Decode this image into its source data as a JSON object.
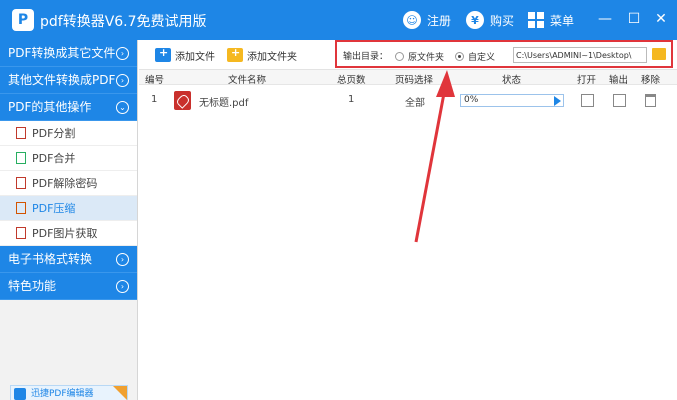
{
  "app": {
    "title": "pdf转换器V6.7免费试用版",
    "logo_text": "P"
  },
  "titlebar": {
    "register_label": "注册",
    "buy_label": "购买",
    "menu_label": "菜单"
  },
  "sidebar": {
    "groups": [
      {
        "label": "PDF转换成其它文件"
      },
      {
        "label": "其他文件转换成PDF"
      },
      {
        "label": "PDF的其他操作"
      },
      {
        "label": "电子书格式转换"
      },
      {
        "label": "特色功能"
      }
    ],
    "items": [
      {
        "label": "PDF分割"
      },
      {
        "label": "PDF合并"
      },
      {
        "label": "PDF解除密码"
      },
      {
        "label": "PDF压缩"
      },
      {
        "label": "PDF图片获取"
      }
    ],
    "promo_text": "迅捷PDF编辑器"
  },
  "toolbar": {
    "add_file_label": "添加文件",
    "add_folder_label": "添加文件夹",
    "output": {
      "label": "输出目录：",
      "option_original": "原文件夹",
      "option_custom": "自定义",
      "selected": "自定义",
      "path": "C:\\Users\\ADMINI~1\\Desktop\\"
    }
  },
  "table": {
    "headers": {
      "index": "编号",
      "filename": "文件名称",
      "pages": "总页数",
      "page_select": "页码选择",
      "status": "状态",
      "open": "打开",
      "export": "输出",
      "remove": "移除"
    },
    "rows": [
      {
        "index": "1",
        "filename": "无标题.pdf",
        "pages": "1",
        "page_select": "全部",
        "progress": "0%"
      }
    ]
  },
  "colors": {
    "accent": "#1e86e6",
    "annotation": "#e0353b"
  }
}
